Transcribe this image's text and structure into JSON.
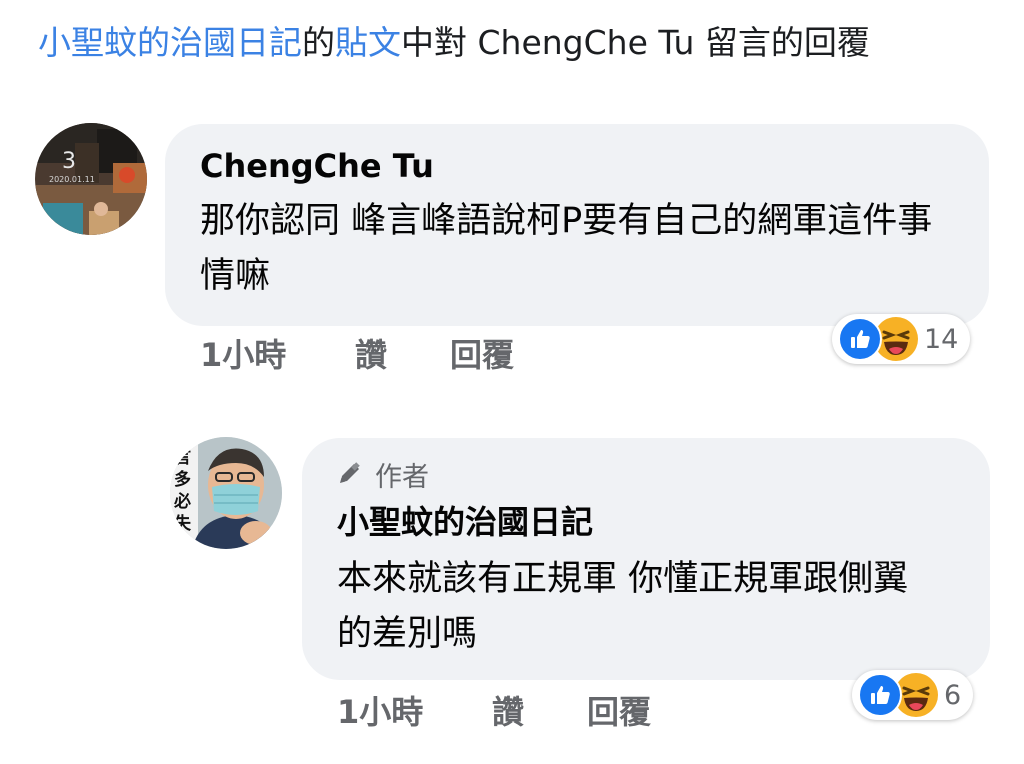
{
  "header": {
    "page_name": "小聖蚊的治國日記",
    "connector_1": "的",
    "post_link": "貼文",
    "connector_2": "中對 ChengChe Tu 留言的回覆"
  },
  "comment": {
    "author": "ChengChe Tu",
    "text": "那你認同 峰言峰語說柯P要有自己的網軍這件事情嘛",
    "time": "1小時",
    "like_label": "讚",
    "reply_label": "回覆",
    "reaction_count": "14",
    "avatar_caption_number": "3",
    "avatar_caption_date": "2020.01.11"
  },
  "reply": {
    "badge_label": "作者",
    "author": "小聖蚊的治國日記",
    "text": "本來就該有正規軍 你懂正規軍跟側翼的差別嗎",
    "time": "1小時",
    "like_label": "讚",
    "reply_label": "回覆",
    "reaction_count": "6",
    "avatar_caption": "言多必失"
  },
  "icons": {
    "author_badge": "pencil-icon",
    "reaction_like": "thumbs-up-icon",
    "reaction_haha": "laughing-face-icon"
  },
  "colors": {
    "link": "#3b82e4",
    "bubble": "#f0f2f5",
    "secondary_text": "#65676b",
    "like_blue": "#1877f2",
    "haha_yellow": "#f7b125"
  }
}
